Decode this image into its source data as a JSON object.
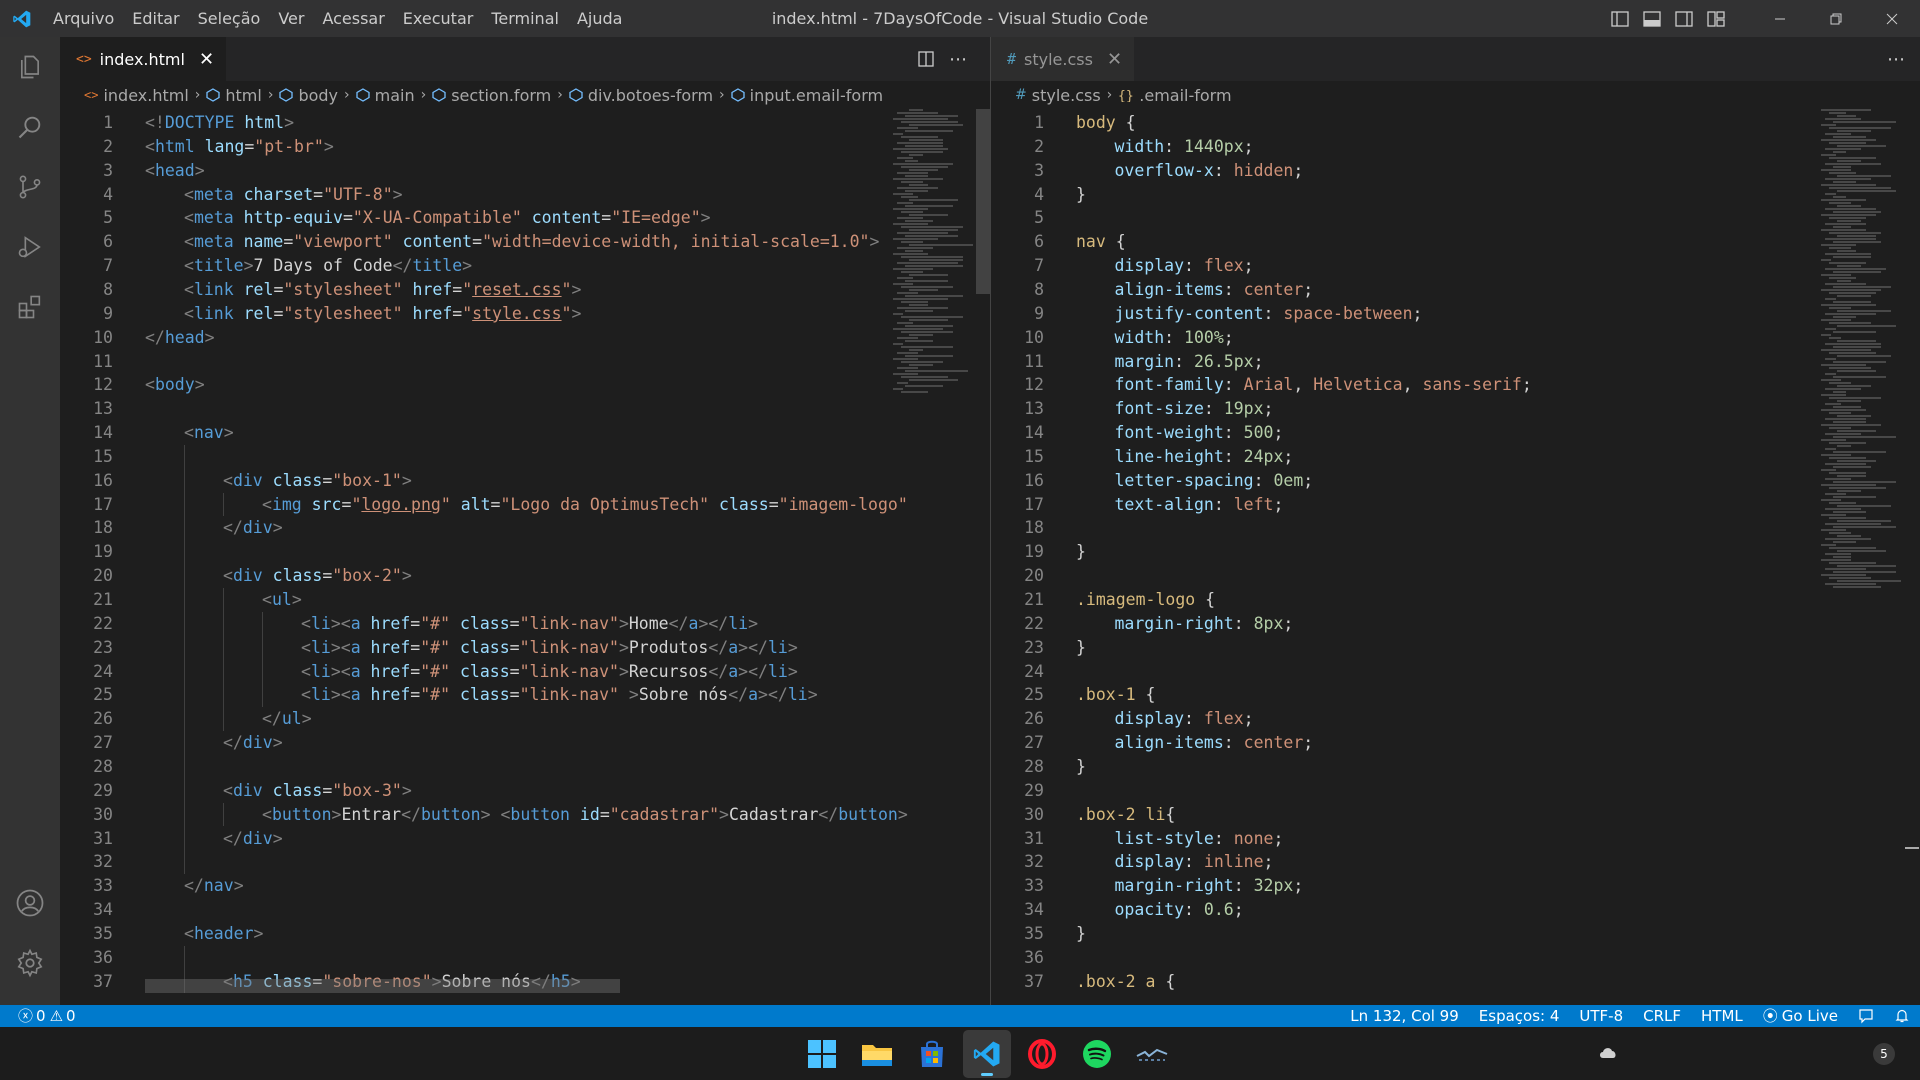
{
  "window": {
    "title": "index.html - 7DaysOfCode - Visual Studio Code",
    "menu": [
      "Arquivo",
      "Editar",
      "Seleção",
      "Ver",
      "Acessar",
      "Executar",
      "Terminal",
      "Ajuda"
    ]
  },
  "activity_bar": {
    "top_icons": [
      "explorer-icon",
      "search-icon",
      "source-control-icon",
      "run-debug-icon",
      "extensions-icon"
    ],
    "bottom_icons": [
      "account-icon",
      "settings-gear-icon"
    ]
  },
  "left_editor": {
    "tab": {
      "label": "index.html",
      "icon": "<>"
    },
    "breadcrumb": [
      "index.html",
      "html",
      "body",
      "main",
      "section.form",
      "div.botoes-form",
      "input.email-form"
    ],
    "lines": [
      {
        "n": "1"
      },
      {
        "n": "2"
      },
      {
        "n": "3"
      },
      {
        "n": "4"
      },
      {
        "n": "5"
      },
      {
        "n": "6"
      },
      {
        "n": "7"
      },
      {
        "n": "8"
      },
      {
        "n": "9"
      },
      {
        "n": "10"
      },
      {
        "n": "11"
      },
      {
        "n": "12"
      },
      {
        "n": "13"
      },
      {
        "n": "14"
      },
      {
        "n": "15"
      },
      {
        "n": "16"
      },
      {
        "n": "17"
      },
      {
        "n": "18"
      },
      {
        "n": "19"
      },
      {
        "n": "20"
      },
      {
        "n": "21"
      },
      {
        "n": "22"
      },
      {
        "n": "23"
      },
      {
        "n": "24"
      },
      {
        "n": "25"
      },
      {
        "n": "26"
      },
      {
        "n": "27"
      },
      {
        "n": "28"
      },
      {
        "n": "29"
      },
      {
        "n": "30"
      },
      {
        "n": "31"
      },
      {
        "n": "32"
      },
      {
        "n": "33"
      },
      {
        "n": "34"
      },
      {
        "n": "35"
      },
      {
        "n": "36"
      },
      {
        "n": "37"
      }
    ],
    "code": {
      "l1": [
        "<!",
        "DOCTYPE",
        " html",
        ">"
      ],
      "l2": [
        "<",
        "html",
        " lang",
        "=",
        "\"pt-br\"",
        ">"
      ],
      "l3": [
        "<",
        "head",
        ">"
      ],
      "l4": [
        "<",
        "meta",
        " charset",
        "=",
        "\"UTF-8\"",
        ">"
      ],
      "l5": [
        "<",
        "meta",
        " http-equiv",
        "=",
        "\"X-UA-Compatible\"",
        " content",
        "=",
        "\"IE=edge\"",
        ">"
      ],
      "l6": [
        "<",
        "meta",
        " name",
        "=",
        "\"viewport\"",
        " content",
        "=",
        "\"width=device-width, initial-scale=1.0\"",
        ">"
      ],
      "l7": [
        "<",
        "title",
        ">",
        "7 Days of Code",
        "</",
        "title",
        ">"
      ],
      "l8": [
        "<",
        "link",
        " rel",
        "=",
        "\"stylesheet\"",
        " href",
        "=",
        "\"",
        "reset.css",
        "\"",
        ">"
      ],
      "l9": [
        "<",
        "link",
        " rel",
        "=",
        "\"stylesheet\"",
        " href",
        "=",
        "\"",
        "style.css",
        "\"",
        ">"
      ],
      "l10": [
        "</",
        "head",
        ">"
      ],
      "l12": [
        "<",
        "body",
        ">"
      ],
      "l14": [
        "<",
        "nav",
        ">"
      ],
      "l16": [
        "<",
        "div",
        " class",
        "=",
        "\"box-1\"",
        ">"
      ],
      "l17": [
        "<",
        "img",
        " src",
        "=",
        "\"",
        "logo.png",
        "\"",
        " alt",
        "=",
        "\"Logo da OptimusTech\"",
        " class",
        "=",
        "\"imagem-logo\""
      ],
      "l18": [
        "</",
        "div",
        ">"
      ],
      "l20": [
        "<",
        "div",
        " class",
        "=",
        "\"box-2\"",
        ">"
      ],
      "l21": [
        "<",
        "ul",
        ">"
      ],
      "l22": [
        "<",
        "li",
        "><",
        "a",
        " href",
        "=",
        "\"#\"",
        " class",
        "=",
        "\"link-nav\"",
        ">",
        "Home",
        "</",
        "a",
        "></",
        "li",
        ">"
      ],
      "l23": [
        "<",
        "li",
        "><",
        "a",
        " href",
        "=",
        "\"#\"",
        " class",
        "=",
        "\"link-nav\"",
        ">",
        "Produtos",
        "</",
        "a",
        "></",
        "li",
        ">"
      ],
      "l24": [
        "<",
        "li",
        "><",
        "a",
        " href",
        "=",
        "\"#\"",
        " class",
        "=",
        "\"link-nav\"",
        ">",
        "Recursos",
        "</",
        "a",
        "></",
        "li",
        ">"
      ],
      "l25": [
        "<",
        "li",
        "><",
        "a",
        " href",
        "=",
        "\"#\"",
        " class",
        "=",
        "\"link-nav\"",
        " >",
        "Sobre nós",
        "</",
        "a",
        "></",
        "li",
        ">"
      ],
      "l26": [
        "</",
        "ul",
        ">"
      ],
      "l27": [
        "</",
        "div",
        ">"
      ],
      "l29": [
        "<",
        "div",
        " class",
        "=",
        "\"box-3\"",
        ">"
      ],
      "l30": [
        "<",
        "button",
        ">",
        "Entrar",
        "</",
        "button",
        "> <",
        "button",
        " id",
        "=",
        "\"cadastrar\"",
        ">",
        "Cadastrar",
        "</",
        "button",
        ">"
      ],
      "l31": [
        "</",
        "div",
        ">"
      ],
      "l33": [
        "</",
        "nav",
        ">"
      ],
      "l35": [
        "<",
        "header",
        ">"
      ],
      "l37": [
        "<",
        "h5",
        " class",
        "=",
        "\"sobre-nos\"",
        ">",
        "Sobre nós",
        "</",
        "h5",
        ">"
      ]
    }
  },
  "right_editor": {
    "tab": {
      "label": "style.css",
      "icon": "#"
    },
    "breadcrumb": [
      "style.css",
      ".email-form"
    ],
    "code": {
      "l1": [
        "body",
        " {"
      ],
      "l2": [
        "width",
        ": ",
        "1440px",
        ";"
      ],
      "l3": [
        "overflow-x",
        ": ",
        "hidden",
        ";"
      ],
      "l4": [
        "}"
      ],
      "l6": [
        "nav",
        " {"
      ],
      "l7": [
        "display",
        ": ",
        "flex",
        ";"
      ],
      "l8": [
        "align-items",
        ": ",
        "center",
        ";"
      ],
      "l9": [
        "justify-content",
        ": ",
        "space-between",
        ";"
      ],
      "l10": [
        "width",
        ": ",
        "100%",
        ";"
      ],
      "l11": [
        "margin",
        ": ",
        "26.5px",
        ";"
      ],
      "l12": [
        "font-family",
        ": ",
        "Arial",
        ", ",
        "Helvetica",
        ", ",
        "sans-serif",
        ";"
      ],
      "l13": [
        "font-size",
        ": ",
        "19px",
        ";"
      ],
      "l14": [
        "font-weight",
        ": ",
        "500",
        ";"
      ],
      "l15": [
        "line-height",
        ": ",
        "24px",
        ";"
      ],
      "l16": [
        "letter-spacing",
        ": ",
        "0em",
        ";"
      ],
      "l17": [
        "text-align",
        ": ",
        "left",
        ";"
      ],
      "l19": [
        "}"
      ],
      "l21": [
        ".imagem-logo",
        " {"
      ],
      "l22": [
        "margin-right",
        ": ",
        "8px",
        ";"
      ],
      "l23": [
        "}"
      ],
      "l25": [
        ".box-1",
        " {"
      ],
      "l26": [
        "display",
        ": ",
        "flex",
        ";"
      ],
      "l27": [
        "align-items",
        ": ",
        "center",
        ";"
      ],
      "l28": [
        "}"
      ],
      "l30": [
        ".box-2 li",
        "{"
      ],
      "l31": [
        "list-style",
        ": ",
        "none",
        ";"
      ],
      "l32": [
        "display",
        ": ",
        "inline",
        ";"
      ],
      "l33": [
        "margin-right",
        ": ",
        "32px",
        ";"
      ],
      "l34": [
        "opacity",
        ": ",
        "0.6",
        ";"
      ],
      "l35": [
        "}"
      ],
      "l37": [
        ".box-2 a",
        " {"
      ]
    }
  },
  "status_bar": {
    "errors": "0",
    "warnings": "0",
    "cursor": "Ln 132, Col 99",
    "spaces": "Espaços: 4",
    "encoding": "UTF-8",
    "eol": "CRLF",
    "language": "HTML",
    "go_live": "Go Live"
  },
  "taskbar": {
    "apps": [
      "windows-start-icon",
      "file-explorer-icon",
      "microsoft-store-icon",
      "vscode-icon",
      "opera-icon",
      "spotify-icon",
      "wallpaper-app-icon"
    ],
    "notification_count": "5"
  },
  "colors": {
    "accent": "#007acc",
    "tag": "#569cd6",
    "attribute": "#9cdcfe",
    "string": "#ce9178",
    "selector": "#d7ba7d",
    "number": "#b5cea8"
  }
}
